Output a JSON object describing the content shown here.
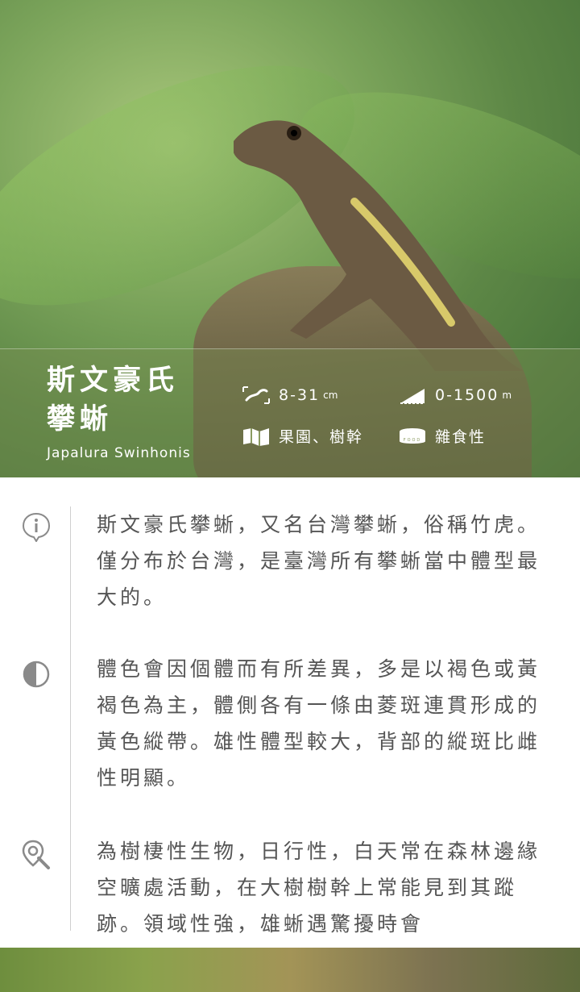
{
  "species": {
    "name_line1": "斯文豪氏",
    "name_line2": "攀蜥",
    "latin": "Japalura Swinhonis"
  },
  "stats": {
    "length_value": "8-31",
    "length_unit": "cm",
    "altitude_value": "0-1500",
    "altitude_unit": "m",
    "habitat": "果園、樹幹",
    "diet": "雜食性",
    "food_label": "FOOD"
  },
  "sections": [
    {
      "icon": "info-icon",
      "text": "斯文豪氏攀蜥，又名台灣攀蜥，俗稱竹虎。僅分布於台灣，是臺灣所有攀蜥當中體型最大的。"
    },
    {
      "icon": "contrast-icon",
      "text": "體色會因個體而有所差異，多是以褐色或黃褐色為主，體側各有一條由菱斑連貫形成的黃色縱帶。雄性體型較大，背部的縱斑比雌性明顯。"
    },
    {
      "icon": "location-search-icon",
      "text": "為樹棲性生物，日行性，白天常在森林邊緣空曠處活動，在大樹樹幹上常能見到其蹤跡。領域性強，雄蜥遇驚擾時會"
    }
  ],
  "colors": {
    "text": "#555555",
    "divider": "#cfcfcf",
    "icon": "#8a8a8a"
  }
}
